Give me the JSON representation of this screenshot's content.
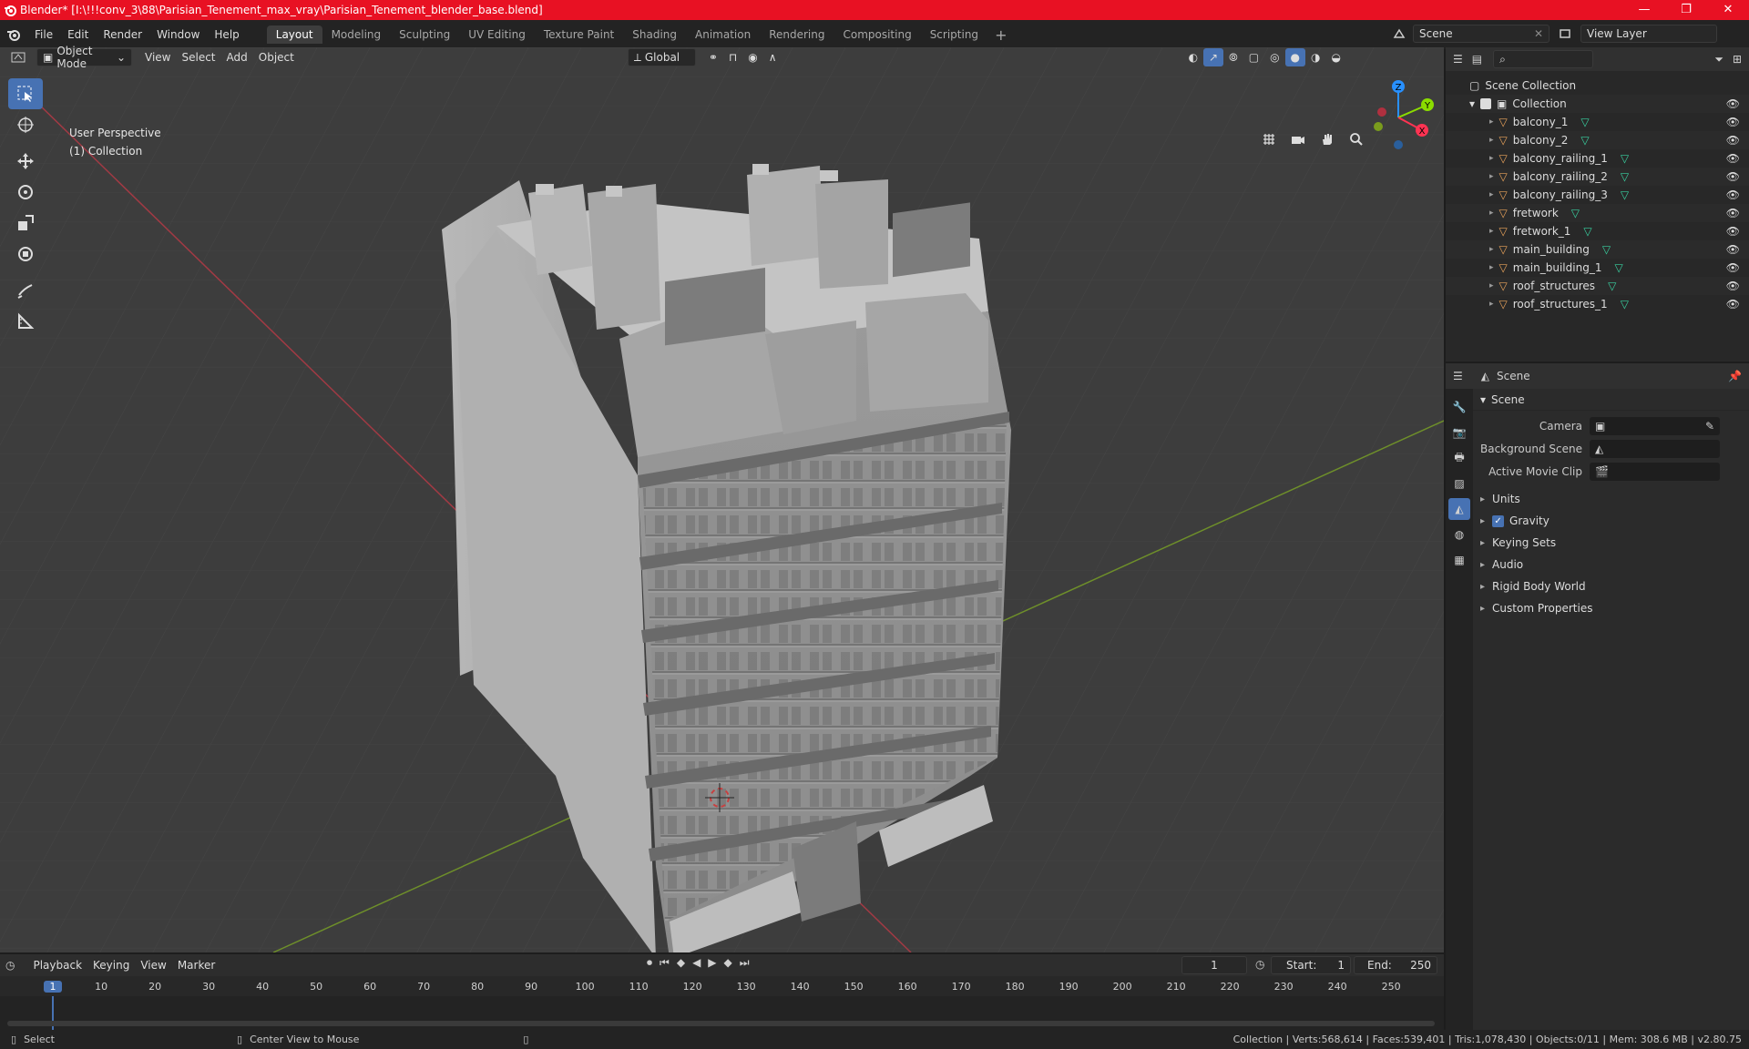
{
  "window": {
    "title": "Blender* [I:\\!!!conv_3\\88\\Parisian_Tenement_max_vray\\Parisian_Tenement_blender_base.blend]",
    "controls": [
      "—",
      "❐",
      "✕"
    ]
  },
  "menu": [
    "File",
    "Edit",
    "Render",
    "Window",
    "Help"
  ],
  "workspaces": [
    "Layout",
    "Modeling",
    "Sculpting",
    "UV Editing",
    "Texture Paint",
    "Shading",
    "Animation",
    "Rendering",
    "Compositing",
    "Scripting"
  ],
  "active_workspace": "Layout",
  "scene_name": "Scene",
  "view_layer": "View Layer",
  "viewport_header": {
    "mode": "Object Mode",
    "menus": [
      "View",
      "Select",
      "Add",
      "Object"
    ],
    "transform": "Global"
  },
  "viewport_info": {
    "perspective": "User Perspective",
    "collection": "(1) Collection"
  },
  "gizmo": {
    "x": "X",
    "y": "Y",
    "z": "Z"
  },
  "outliner": {
    "root": "Scene Collection",
    "collection": "Collection",
    "items": [
      "balcony_1",
      "balcony_2",
      "balcony_railing_1",
      "balcony_railing_2",
      "balcony_railing_3",
      "fretwork",
      "fretwork_1",
      "main_building",
      "main_building_1",
      "roof_structures",
      "roof_structures_1"
    ]
  },
  "properties": {
    "header": "Scene",
    "panel": "Scene",
    "fields": [
      {
        "label": "Camera"
      },
      {
        "label": "Background Scene"
      },
      {
        "label": "Active Movie Clip"
      }
    ],
    "subpanels": [
      "Units",
      "Gravity",
      "Keying Sets",
      "Audio",
      "Rigid Body World",
      "Custom Properties"
    ],
    "gravity_checked": true
  },
  "timeline": {
    "menus": [
      "Playback",
      "Keying",
      "View",
      "Marker"
    ],
    "current_frame": "1",
    "start_label": "Start:",
    "start": "1",
    "end_label": "End:",
    "end": "250",
    "ticks": [
      "1",
      "10",
      "20",
      "30",
      "40",
      "50",
      "60",
      "70",
      "80",
      "90",
      "100",
      "110",
      "120",
      "130",
      "140",
      "150",
      "160",
      "170",
      "180",
      "190",
      "200",
      "210",
      "220",
      "230",
      "240",
      "250"
    ]
  },
  "statusbar": {
    "left": "Select",
    "middle": "Center View to Mouse",
    "right": "Collection | Verts:568,614 | Faces:539,401 | Tris:1,078,430 | Objects:0/11 | Mem: 308.6 MB | v2.80.75"
  },
  "colors": {
    "titlebar": "#e81123",
    "accent": "#4772b3",
    "mesh_icon": "#e8a25a",
    "data_icon": "#39d0a0",
    "x_axis": "#ff3352",
    "y_axis": "#8bdc00",
    "z_axis": "#2890ff"
  }
}
